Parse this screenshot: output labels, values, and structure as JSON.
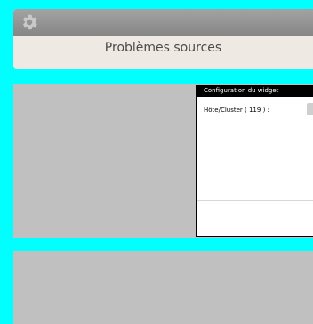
{
  "header": {
    "title": "Problèmes sources",
    "icon": "gear-icon"
  },
  "config_dialog": {
    "title": "Configuration du widget",
    "host_cluster_label": "Hôte/Cluster ( 119 ) :"
  },
  "colors": {
    "background": "#00ffff",
    "panel": "#c0c0c0",
    "header_bar": "#969696",
    "header_body": "#eeeae3",
    "dialog_title_bar": "#000000"
  }
}
